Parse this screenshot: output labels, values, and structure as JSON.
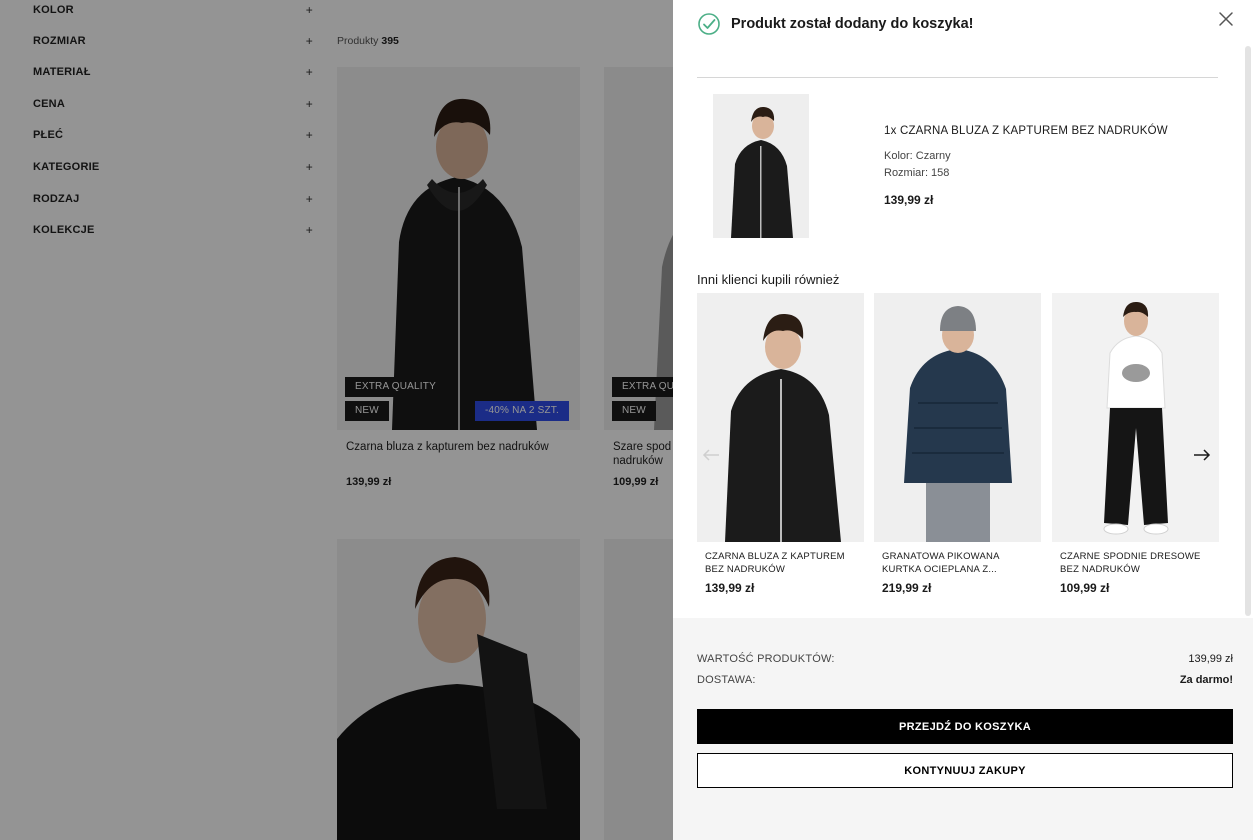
{
  "filters": [
    {
      "label": "KOLOR"
    },
    {
      "label": "ROZMIAR"
    },
    {
      "label": "MATERIAŁ"
    },
    {
      "label": "CENA"
    },
    {
      "label": "PŁEĆ"
    },
    {
      "label": "KATEGORIE"
    },
    {
      "label": "RODZAJ"
    },
    {
      "label": "KOLEKCJE"
    }
  ],
  "filter_plus": "+",
  "listing": {
    "count_label": "Produkty",
    "count_value": "395",
    "products": [
      {
        "name": "Czarna bluza z kapturem bez nadruków",
        "price": "139,99 zł",
        "badge_quality": "EXTRA QUALITY",
        "badge_new": "NEW",
        "badge_promo": "-40% NA 2 SZT."
      },
      {
        "name": "Szare spod nadruków",
        "price": "109,99 zł",
        "badge_quality": "EXTRA QU",
        "badge_new": "NEW"
      }
    ]
  },
  "drawer": {
    "title": "Produkt został dodany do koszyka!",
    "added": {
      "name": "1x CZARNA BLUZA Z KAPTUREM BEZ NADRUKÓW",
      "color": "Kolor: Czarny",
      "size": "Rozmiar: 158",
      "price": "139,99 zł"
    },
    "recommend_title": "Inni klienci kupili również",
    "recommendations": [
      {
        "name": "CZARNA BLUZA Z KAPTUREM BEZ NADRUKÓW",
        "price": "139,99 zł"
      },
      {
        "name": "GRANATOWA PIKOWANA KURTKA OCIEPLANA Z...",
        "price": "219,99 zł"
      },
      {
        "name": "CZARNE SPODNIE DRESOWE BEZ NADRUKÓW",
        "price": "109,99 zł"
      }
    ],
    "summary": {
      "products_label": "WARTOŚĆ PRODUKTÓW:",
      "products_value": "139,99 zł",
      "delivery_label": "DOSTAWA:",
      "delivery_value": "Za darmo!"
    },
    "buttons": {
      "checkout": "PRZEJDŹ DO KOSZYKA",
      "continue": "KONTYNUUJ ZAKUPY"
    }
  }
}
